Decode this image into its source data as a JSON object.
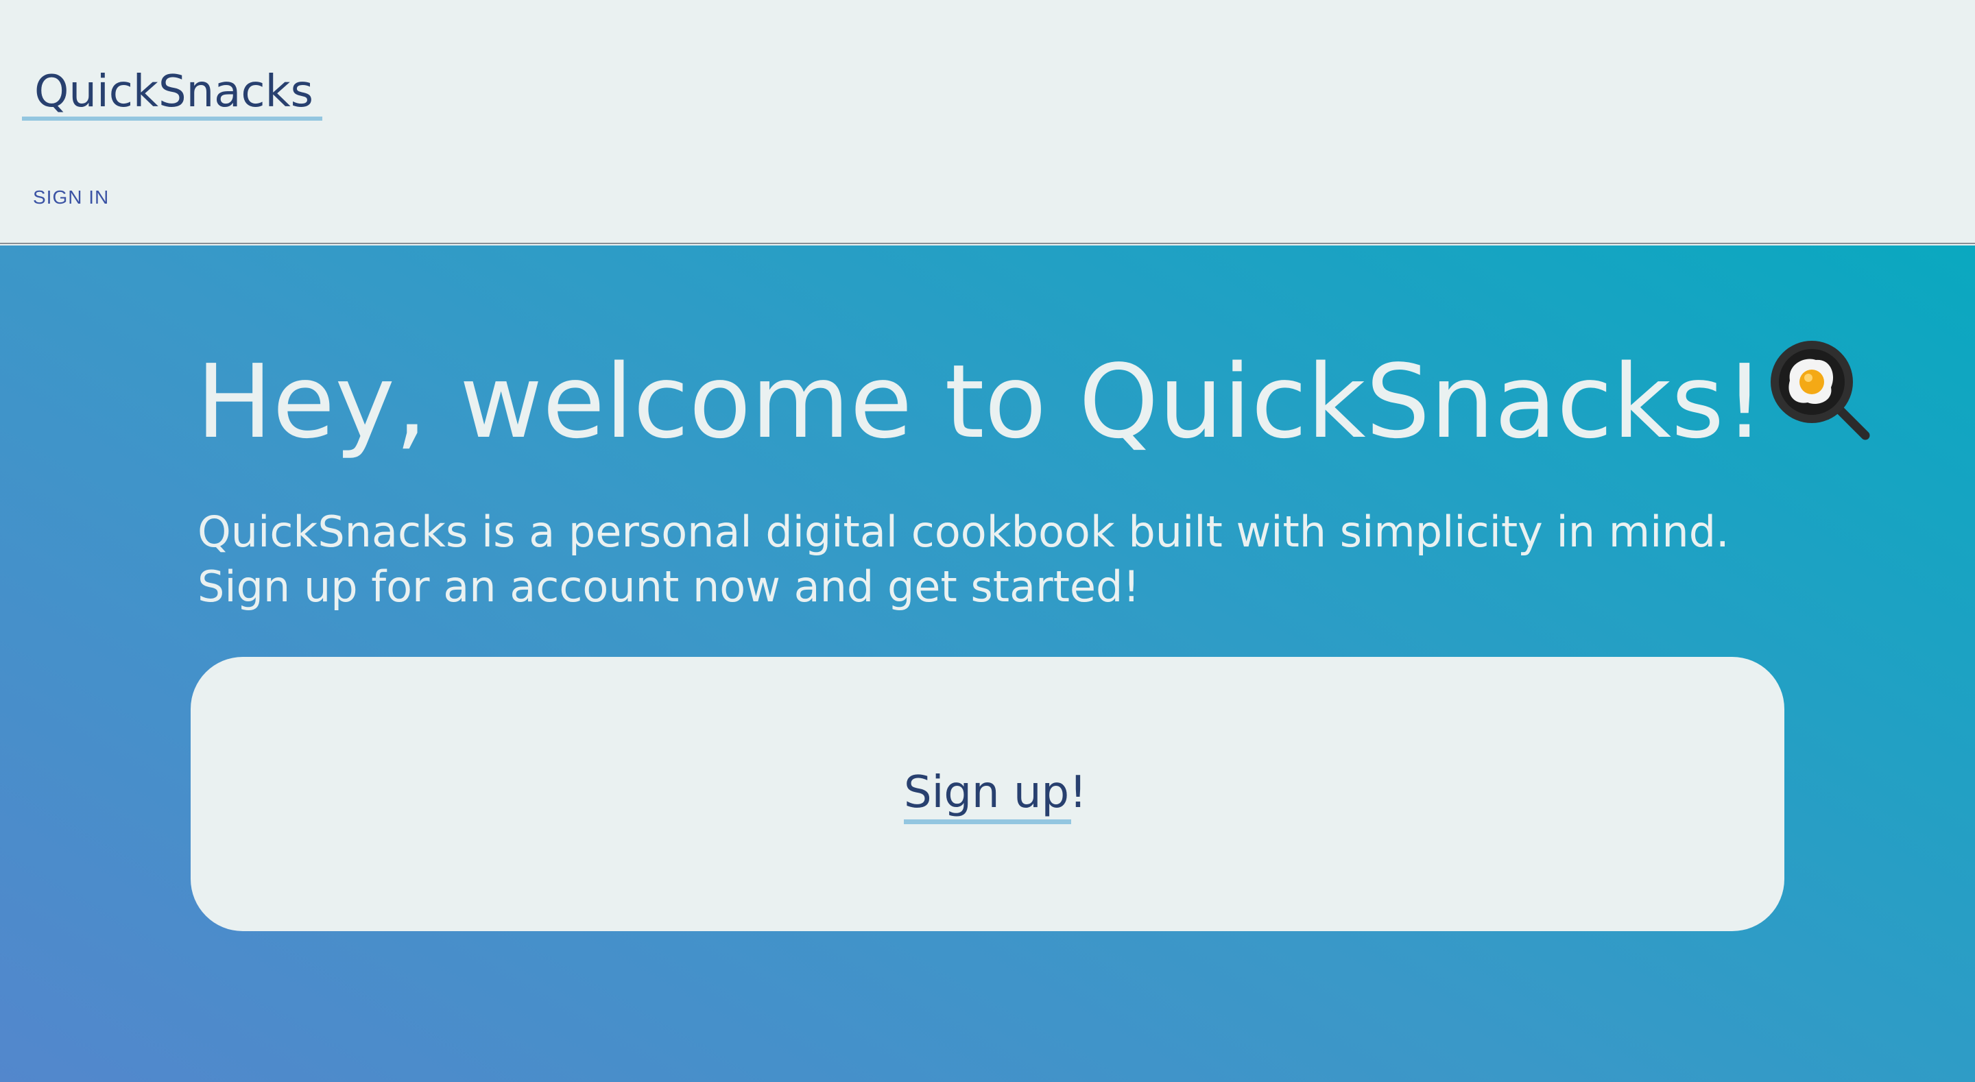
{
  "header": {
    "brand": "QuickSnacks",
    "sign_in_label": "SIGN IN"
  },
  "hero": {
    "title": "Hey, welcome to QuickSnacks!",
    "title_icon": "frying-pan-egg-icon",
    "description": "QuickSnacks is a personal digital cookbook built with simplicity in mind. Sign up for an account now and get started!",
    "signup_label": "Sign up!"
  },
  "colors": {
    "background": "#eaf1f1",
    "text_dark": "#28406f",
    "link_accent": "#3b53a4",
    "underline": "#93c6e0",
    "gradient_start": "#5387cc",
    "gradient_end": "#0aa8c0"
  }
}
